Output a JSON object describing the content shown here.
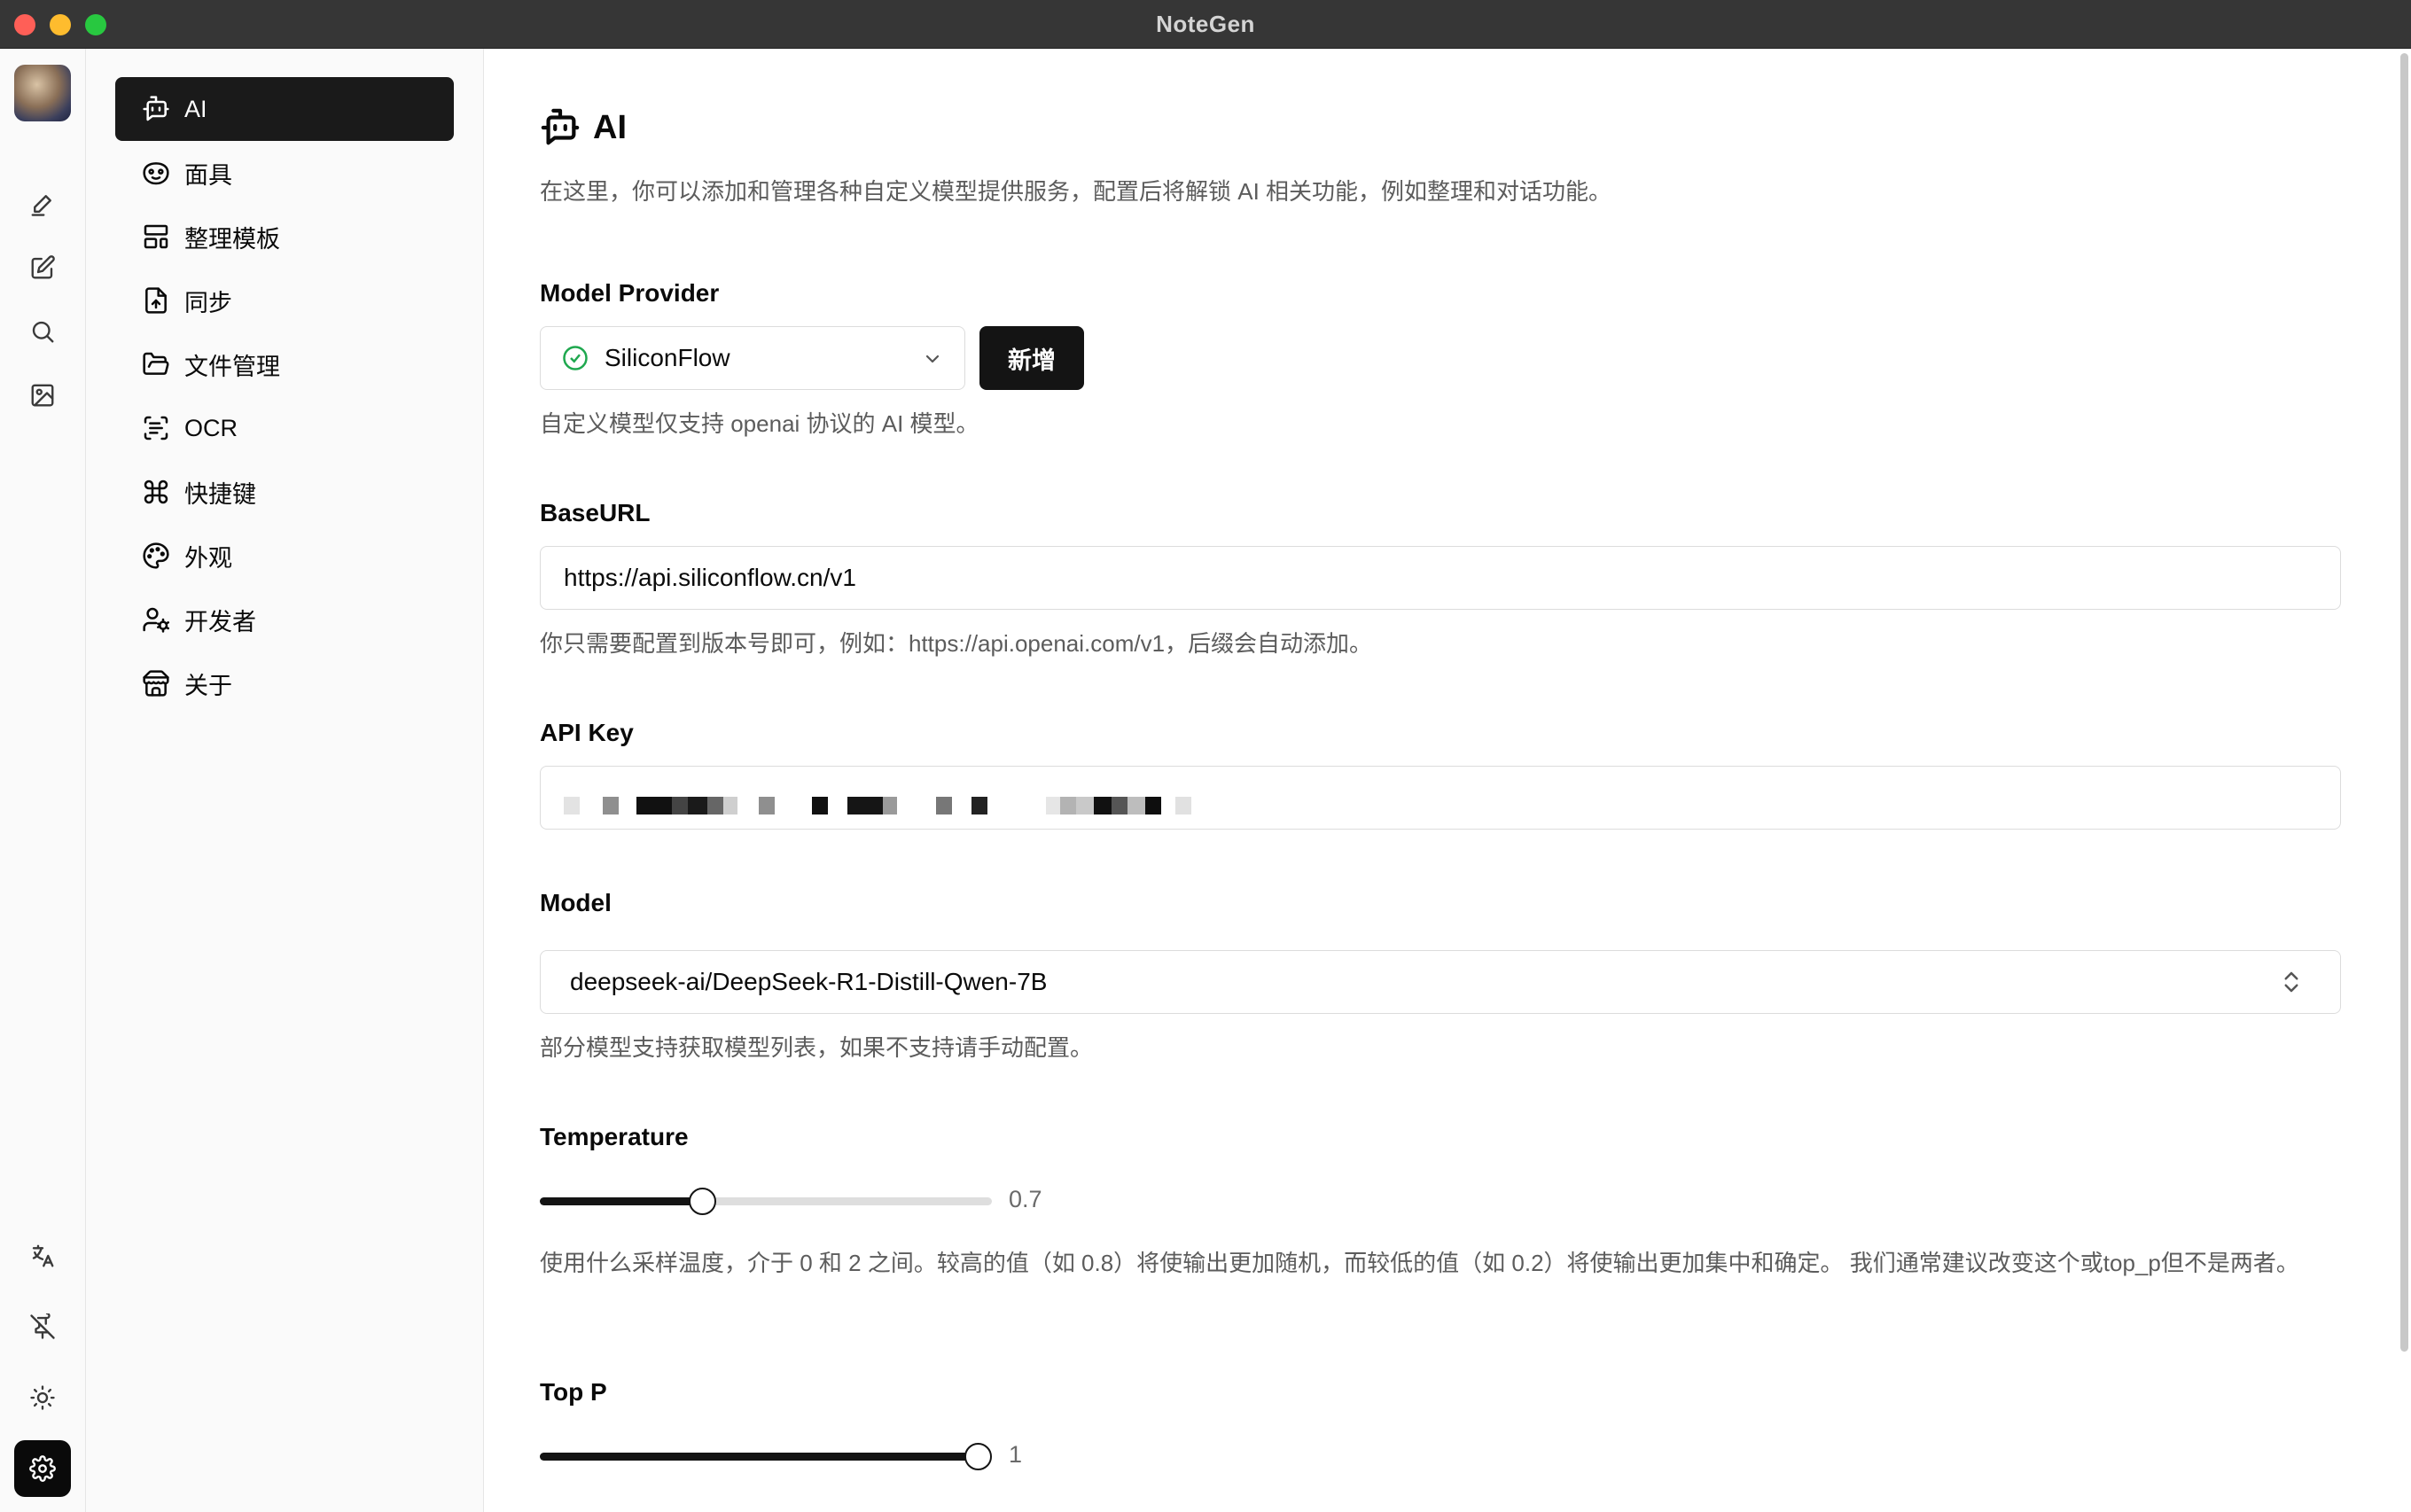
{
  "window": {
    "title": "NoteGen"
  },
  "activity_bar": {
    "top_items": [
      "avatar",
      "pen-icon",
      "edit-icon",
      "search-icon",
      "image-icon"
    ],
    "bottom_items": [
      "translate-icon",
      "pin-off-icon",
      "sun-icon",
      "gear-icon"
    ],
    "active": "gear-icon"
  },
  "settings_nav": {
    "items": [
      {
        "label": "AI",
        "icon": "bot-icon",
        "active": true
      },
      {
        "label": "面具",
        "icon": "mask-icon"
      },
      {
        "label": "整理模板",
        "icon": "layout-template-icon"
      },
      {
        "label": "同步",
        "icon": "file-upload-icon"
      },
      {
        "label": "文件管理",
        "icon": "folder-open-icon"
      },
      {
        "label": "OCR",
        "icon": "scan-text-icon"
      },
      {
        "label": "快捷键",
        "icon": "command-icon"
      },
      {
        "label": "外观",
        "icon": "palette-icon"
      },
      {
        "label": "开发者",
        "icon": "user-cog-icon"
      },
      {
        "label": "关于",
        "icon": "store-icon"
      }
    ]
  },
  "page": {
    "icon": "bot-icon",
    "title": "AI",
    "description": "在这里，你可以添加和管理各种自定义模型提供服务，配置后将解锁 AI 相关功能，例如整理和对话功能。"
  },
  "model_provider": {
    "label": "Model Provider",
    "selected": "SiliconFlow",
    "status_icon": "check-circle-icon",
    "add_button": "新增",
    "hint": "自定义模型仅支持 openai 协议的 AI 模型。"
  },
  "base_url": {
    "label": "BaseURL",
    "value": "https://api.siliconflow.cn/v1",
    "hint": "你只需要配置到版本号即可，例如：https://api.openai.com/v1，后缀会自动添加。"
  },
  "api_key": {
    "label": "API Key",
    "value_state": "pixelated"
  },
  "model": {
    "label": "Model",
    "selected": "deepseek-ai/DeepSeek-R1-Distill-Qwen-7B",
    "hint": "部分模型支持获取模型列表，如果不支持请手动配置。"
  },
  "temperature": {
    "label": "Temperature",
    "value": 0.7,
    "value_text": "0.7",
    "min": 0,
    "max": 2,
    "hint": "使用什么采样温度，介于 0 和 2 之间。较高的值（如 0.8）将使输出更加随机，而较低的值（如 0.2）将使输出更加集中和确定。 我们通常建议改变这个或top_p但不是两者。"
  },
  "top_p": {
    "label": "Top P",
    "value": 1,
    "value_text": "1",
    "min": 0,
    "max": 1
  },
  "colors": {
    "accent": "#141414",
    "success": "#1fa84f",
    "titlebar": "#363636"
  }
}
